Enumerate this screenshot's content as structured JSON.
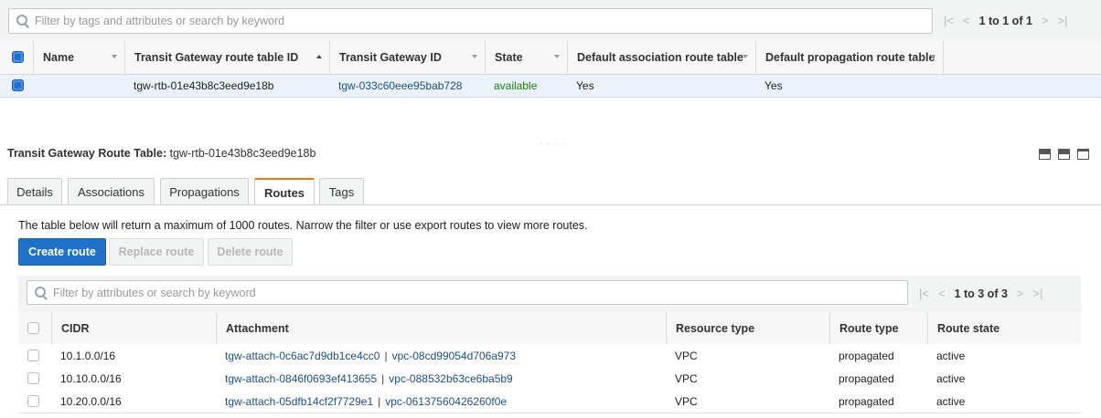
{
  "top_table": {
    "search_placeholder": "Filter by tags and attributes or search by keyword",
    "pagination": "1 to 1 of 1",
    "columns": [
      "Name",
      "Transit Gateway route table ID",
      "Transit Gateway ID",
      "State",
      "Default association route table",
      "Default propagation route table"
    ],
    "row": {
      "name": "",
      "route_table_id": "tgw-rtb-01e43b8c3eed9e18b",
      "gateway_id": "tgw-033c60eee95bab728",
      "state": "available",
      "default_association": "Yes",
      "default_propagation": "Yes"
    }
  },
  "detail": {
    "title_label": "Transit Gateway Route Table:",
    "title_value": "tgw-rtb-01e43b8c3eed9e18b",
    "tabs": [
      "Details",
      "Associations",
      "Propagations",
      "Routes",
      "Tags"
    ],
    "active_tab": "Routes",
    "info_text": "The table below will return a maximum of 1000 routes. Narrow the filter or use export routes to view more routes.",
    "buttons": {
      "create": "Create route",
      "replace": "Replace route",
      "delete": "Delete route"
    }
  },
  "routes_table": {
    "search_placeholder": "Filter by attributes or search by keyword",
    "pagination": "1 to 3 of 3",
    "columns": [
      "CIDR",
      "Attachment",
      "Resource type",
      "Route type",
      "Route state"
    ],
    "rows": [
      {
        "cidr": "10.1.0.0/16",
        "attachment_id": "tgw-attach-0c6ac7d9db1ce4cc0",
        "vpc_id": "vpc-08cd99054d706a973",
        "resource_type": "VPC",
        "route_type": "propagated",
        "route_state": "active"
      },
      {
        "cidr": "10.10.0.0/16",
        "attachment_id": "tgw-attach-0846f0693ef413655",
        "vpc_id": "vpc-088532b63ce6ba5b9",
        "resource_type": "VPC",
        "route_type": "propagated",
        "route_state": "active"
      },
      {
        "cidr": "10.20.0.0/16",
        "attachment_id": "tgw-attach-05dfb14cf2f7729e1",
        "vpc_id": "vpc-06137560426260f0e",
        "resource_type": "VPC",
        "route_type": "propagated",
        "route_state": "active"
      }
    ]
  },
  "colors": {
    "primary_button": "#1f72c7",
    "link": "#1d4e89",
    "available": "#1d8102",
    "active_tab_accent": "#e47911",
    "selected_row": "#e9f2fd"
  },
  "icons": [
    "search-icon",
    "first-page-icon",
    "prev-page-icon",
    "next-page-icon",
    "last-page-icon",
    "sort-icon",
    "split-view-icon"
  ]
}
